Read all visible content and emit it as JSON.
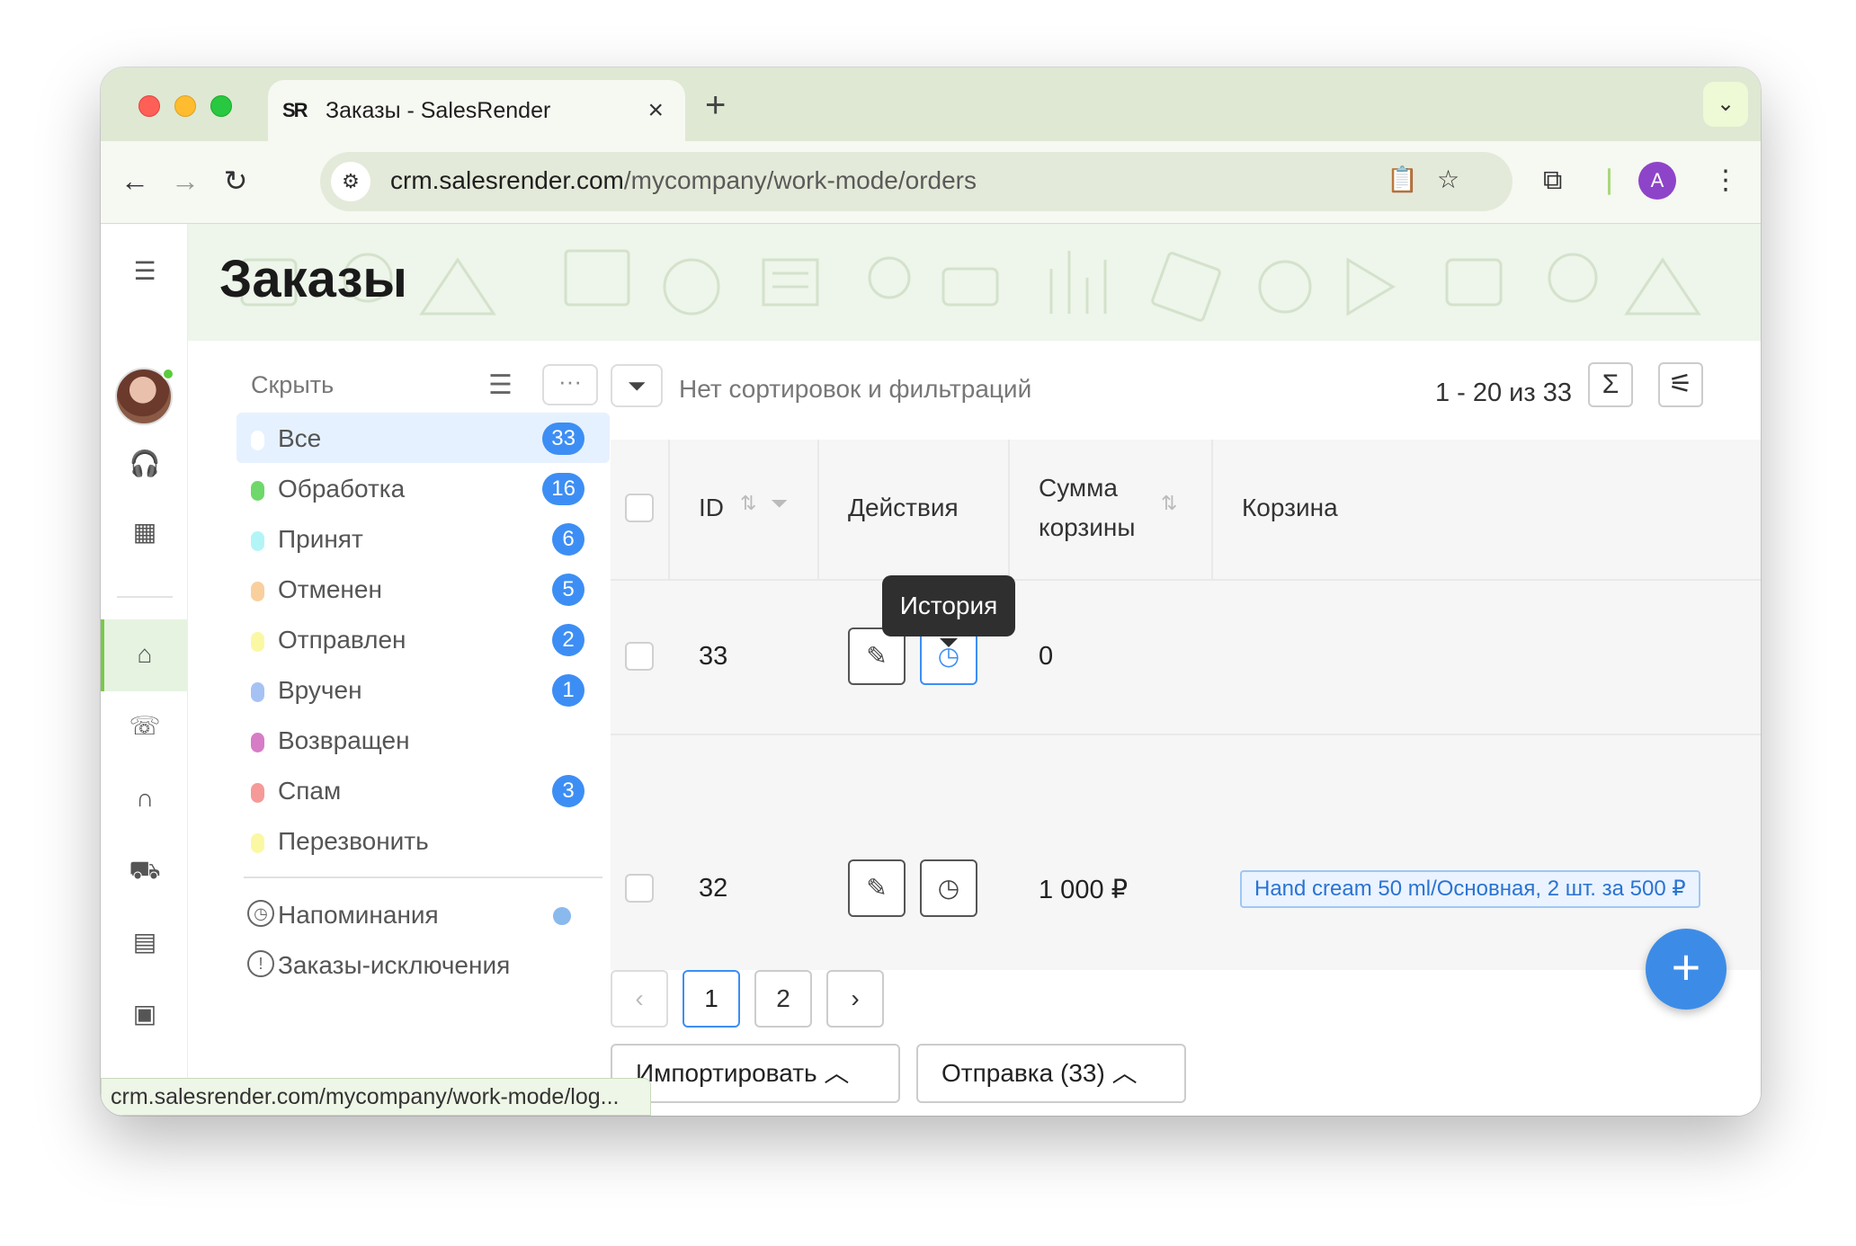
{
  "browser": {
    "tab_title": "Заказы - SalesRender",
    "tab_logo": "SR",
    "url_host": "crm.salesrender.com",
    "url_path": "/mycompany/work-mode/orders",
    "profile_letter": "A",
    "status_url": "crm.salesrender.com/mycompany/work-mode/log..."
  },
  "page": {
    "title": "Заказы"
  },
  "sidebar": {
    "hide_label": "Скрыть",
    "more_label": "···",
    "statuses": [
      {
        "label": "Все",
        "count": "33",
        "color": "#ffffff"
      },
      {
        "label": "Обработка",
        "count": "16",
        "color": "#6fd86a"
      },
      {
        "label": "Принят",
        "count": "6",
        "color": "#b3f5f7"
      },
      {
        "label": "Отменен",
        "count": "5",
        "color": "#f9cf9d"
      },
      {
        "label": "Отправлен",
        "count": "2",
        "color": "#fbf8a4"
      },
      {
        "label": "Вручен",
        "count": "1",
        "color": "#a6c2f5"
      },
      {
        "label": "Возвращен",
        "count": "",
        "color": "#d77cc6"
      },
      {
        "label": "Спам",
        "count": "3",
        "color": "#f59a98"
      },
      {
        "label": "Перезвонить",
        "count": "",
        "color": "#fbf8a4"
      }
    ],
    "extras": [
      {
        "label": "Напоминания"
      },
      {
        "label": "Заказы-исключения"
      }
    ]
  },
  "toolbar": {
    "filter_text": "Нет сортировок и фильтраций",
    "page_count": "1 - 20 из 33",
    "sum_symbol": "Σ"
  },
  "table": {
    "headers": {
      "id": "ID",
      "actions": "Действия",
      "basket_sum_1": "Сумма",
      "basket_sum_2": "корзины",
      "basket": "Корзина"
    },
    "tooltip": "История",
    "rows": [
      {
        "id": "33",
        "sum": "0",
        "basket": ""
      },
      {
        "id": "32",
        "sum": "1 000 ₽",
        "basket": "Hand cream 50 ml/Основная, 2 шт. за 500 ₽"
      }
    ]
  },
  "pagination": {
    "pages": [
      "1",
      "2"
    ],
    "prev": "‹",
    "next": "›"
  },
  "bottom": {
    "import_label": "Импортировать",
    "send_label": "Отправка (33)"
  },
  "colors": {
    "accent": "#3d8ef4",
    "active_nav": "#79c94a"
  }
}
